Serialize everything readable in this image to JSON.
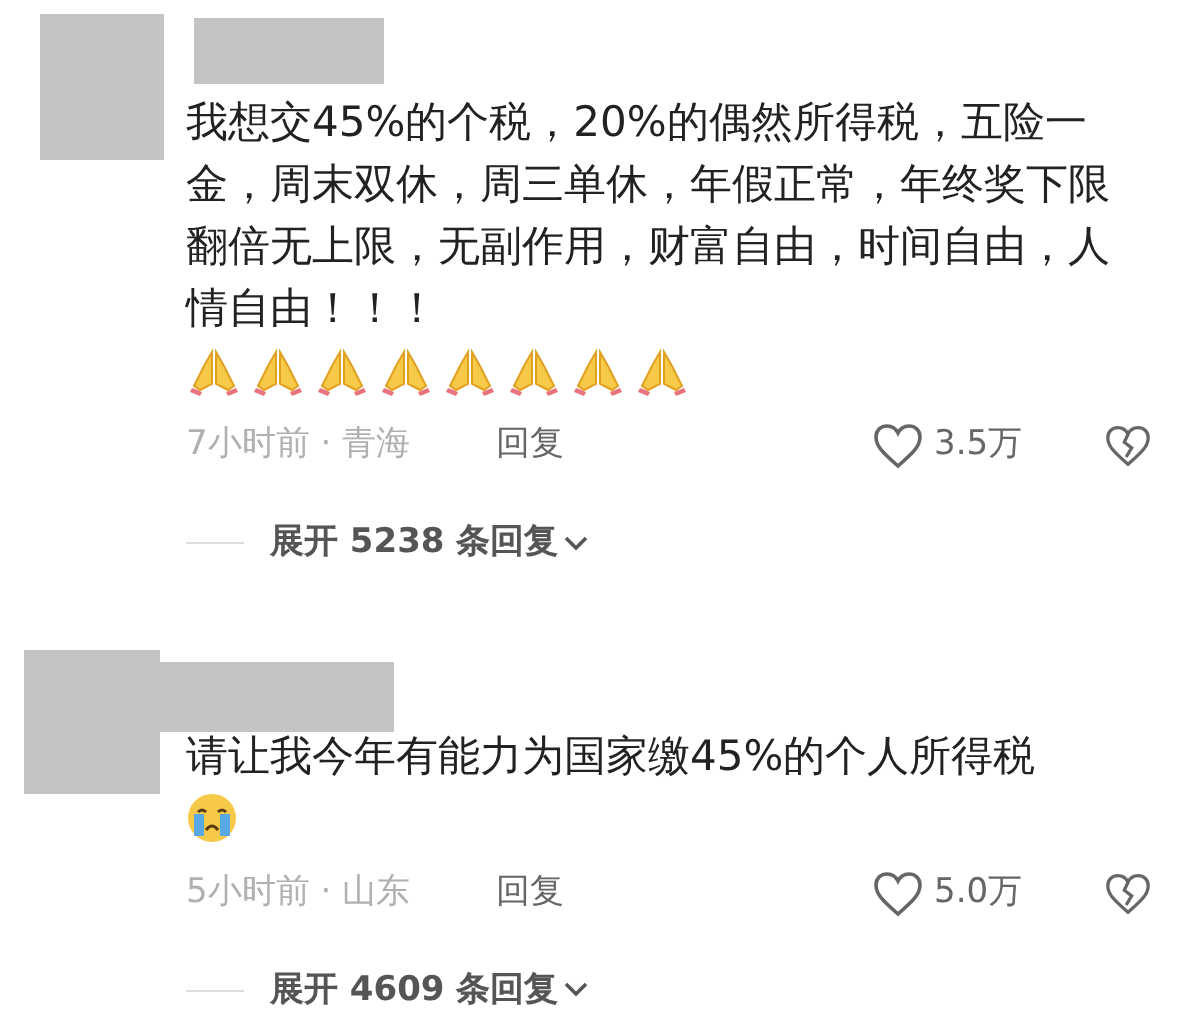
{
  "comments": [
    {
      "text": "我想交45%的个税，20%的偶然所得税，五险一金，周末双休，周三单休，年假正常，年终奖下限翻倍无上限，无副作用，财富自由，时间自由，人情自由！！！",
      "emojis": [
        {
          "kind": "pray"
        },
        {
          "kind": "pray"
        },
        {
          "kind": "pray"
        },
        {
          "kind": "pray"
        },
        {
          "kind": "pray"
        },
        {
          "kind": "pray"
        },
        {
          "kind": "pray"
        },
        {
          "kind": "pray"
        }
      ],
      "time_location": "7小时前 · 青海",
      "reply": "回复",
      "likes": "3.5万",
      "expand": "展开 5238 条回复"
    },
    {
      "text": "请让我今年有能力为国家缴45%的个人所得税",
      "emojis": [
        {
          "kind": "cry"
        }
      ],
      "time_location": "5小时前 · 山东",
      "reply": "回复",
      "likes": "5.0万",
      "expand": "展开 4609 条回复"
    }
  ]
}
